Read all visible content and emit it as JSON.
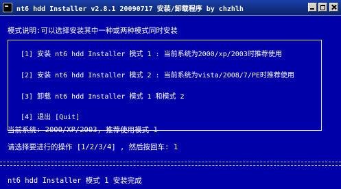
{
  "window": {
    "title": "nt6 hdd Installer v2.8.1 20090717 安装/卸载程序 by chzhlh"
  },
  "console": {
    "mode_description": "模式说明:可以选择安装其中一种或两种模式同时安装",
    "menu_items": [
      "[1] 安装 nt6 hdd Installer 模式 1 : 当前系统为2000/xp/2003时推荐使用",
      "[2] 安装 nt6 hdd Installer 模式 2 : 当前系统为vista/2008/7/PE时推荐使用",
      "[3] 卸载 nt6 hdd Installer 模式 1 和模式 2",
      "[4] 退出 [Quit]"
    ],
    "current_system": "当前系统: 2000/XP/2003, 推荐使用模式 1",
    "prompt": "请选择要进行的操作 [1/2/3/4] , 然后按回车: 1",
    "status": "nt6 hdd Installer 模式 1 安装完成"
  },
  "colors": {
    "console_background": "#0000a8",
    "console_text": "#ffffff",
    "titlebar": "#0a246a"
  },
  "icons": {
    "app": "console-app-icon",
    "minimize": "minimize-icon",
    "maximize": "maximize-icon",
    "close": "close-icon"
  }
}
